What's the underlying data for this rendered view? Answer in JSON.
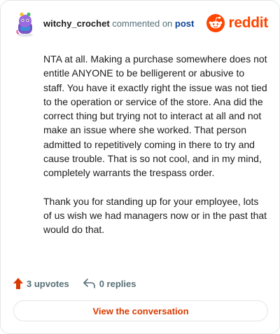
{
  "header": {
    "username": "witchy_crochet",
    "action": "commented on",
    "post_link": "post",
    "brand": "reddit"
  },
  "comment": {
    "paragraphs": [
      "NTA at all. Making a purchase somewhere does not entitle ANYONE to be belligerent or abusive to staff. You have it exactly right the issue was not tied to the operation or service of the store. Ana did the correct thing but trying not to interact at all and not make an issue where she worked. That person admitted to repetitively coming in there to try and cause trouble. That is so not cool, and in my mind, completely warrants the trespass order.",
      "Thank you for standing up for your employee, lots of us wish we had managers now or in the past that would do that."
    ]
  },
  "footer": {
    "upvotes": "3 upvotes",
    "replies": "0 replies"
  },
  "cta": {
    "label": "View the conversation"
  },
  "icons": {
    "upvote": "upvote-arrow-icon",
    "reply": "reply-arrow-icon",
    "brand": "reddit-logo-icon"
  },
  "colors": {
    "brand": "#ff4500",
    "cta": "#d93a00",
    "link": "#0a449b",
    "muted": "#576f76"
  }
}
